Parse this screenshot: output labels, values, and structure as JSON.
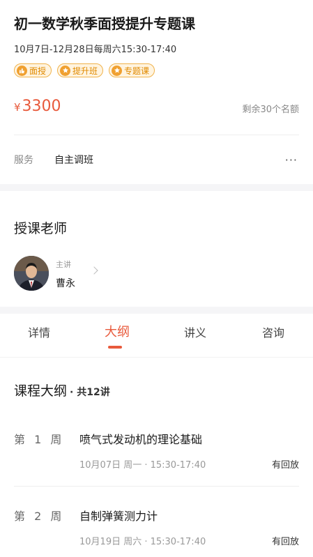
{
  "course": {
    "title": "初一数学秋季面授提升专题课",
    "schedule": "10月7日-12月28日每周六15:30-17:40",
    "tags": [
      {
        "icon": "thumbs-up-icon",
        "label": "面授"
      },
      {
        "icon": "star-icon",
        "label": "提升班"
      },
      {
        "icon": "star-icon",
        "label": "专题课"
      }
    ],
    "price_symbol": "¥",
    "price": "3300",
    "remaining": "剩余30个名额"
  },
  "service": {
    "label": "服务",
    "value": "自主调班"
  },
  "teacher_section": {
    "heading": "授课老师",
    "role": "主讲",
    "name": "曹永"
  },
  "tabs": [
    {
      "label": "详情"
    },
    {
      "label": "大纲"
    },
    {
      "label": "讲义"
    },
    {
      "label": "咨询"
    }
  ],
  "active_tab": "大纲",
  "syllabus": {
    "heading": "课程大纲",
    "count": "· 共12讲",
    "lessons": [
      {
        "week": "第 1 周",
        "title": "喷气式发动机的理论基础",
        "time": "10月07日 周一 · 15:30-17:40",
        "replay": "有回放"
      },
      {
        "week": "第 2 周",
        "title": "自制弹簧测力计",
        "time": "10月19日 周六 · 15:30-17:40",
        "replay": "有回放"
      }
    ]
  },
  "colors": {
    "accent": "#e85a3c",
    "tag_orange": "#f0a030",
    "band_gray": "#f5f5f7"
  }
}
